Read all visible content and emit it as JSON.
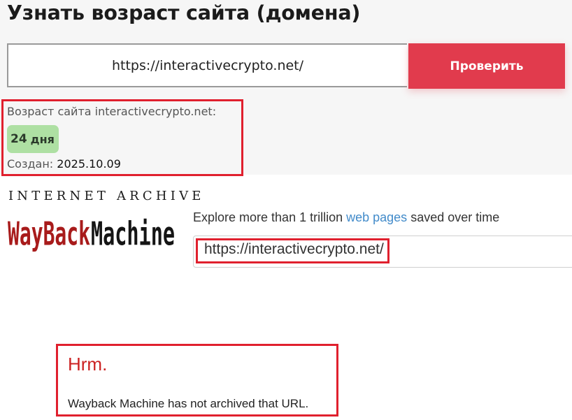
{
  "header": {
    "title": "Узнать возраст сайта (домена)"
  },
  "checker": {
    "url_value": "https://interactivecrypto.net/",
    "button_label": "Проверить"
  },
  "result": {
    "age_label": "Возраст сайта interactivecrypto.net:",
    "age_number": "24",
    "age_unit": "дня",
    "created_label": "Создан:",
    "created_date": "2025.10.09",
    "badge_color": "#aee0a3"
  },
  "wayback": {
    "internet_archive": "INTERNET ARCHIVE",
    "logo_wayback": "WayBack",
    "logo_machine": "Machine",
    "tagline_before": "Explore more than 1 trillion ",
    "tagline_link": "web pages",
    "tagline_after": " saved over time",
    "search_value": "https://interactivecrypto.net/",
    "heading": "Hrm.",
    "message": "Wayback Machine has not archived that URL."
  },
  "colors": {
    "accent_button": "#e13b4d",
    "highlight_frame": "#e0202e",
    "link": "#428bca",
    "wayback_red": "#a81b1b",
    "error_heading": "#cc2222"
  }
}
